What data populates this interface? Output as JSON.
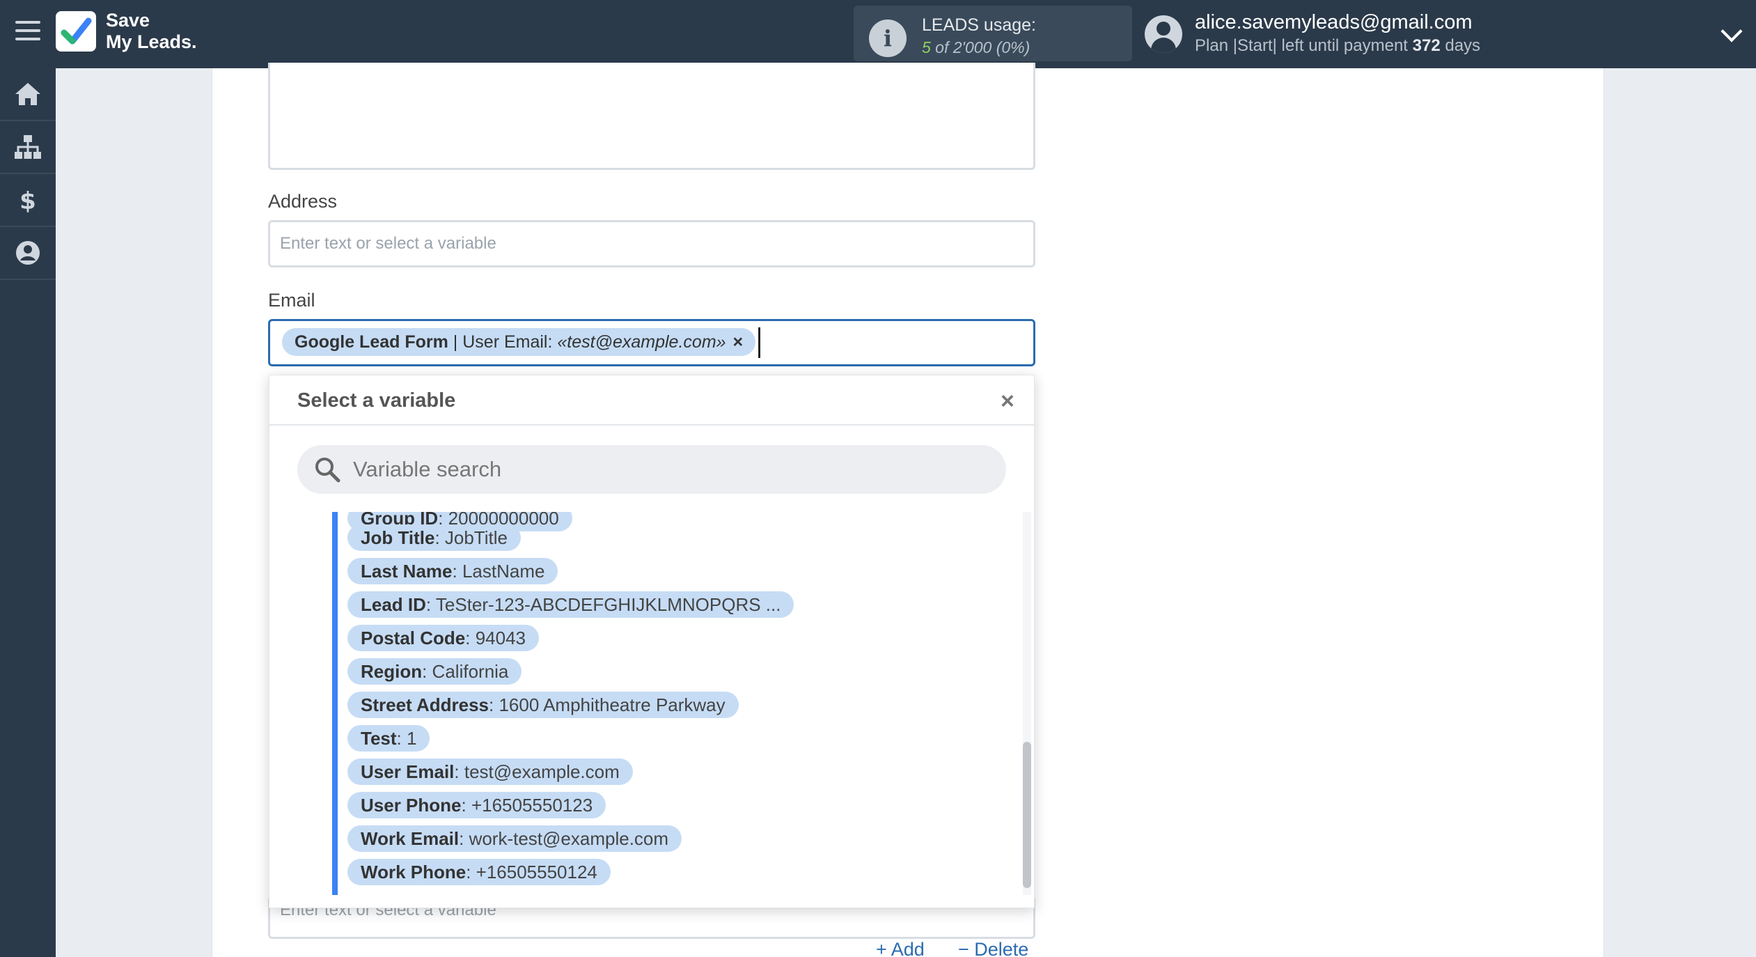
{
  "header": {
    "logo_line1": "Save",
    "logo_line2": "My Leads.",
    "leads_title": "LEADS usage:",
    "leads_used": "5",
    "leads_total": " of 2'000",
    "leads_percent": " (0%)",
    "user_email": "alice.savemyleads@gmail.com",
    "plan_prefix": "Plan |Start| left until payment ",
    "plan_days": "372",
    "plan_suffix": " days"
  },
  "sidebar": {
    "items": [
      {
        "name": "home-icon"
      },
      {
        "name": "sitemap-icon"
      },
      {
        "name": "dollar-icon"
      },
      {
        "name": "user-circle-icon"
      }
    ]
  },
  "form": {
    "address_label": "Address",
    "address_placeholder": "Enter text or select a variable",
    "email_label": "Email",
    "email_chip": {
      "source": "Google Lead Form",
      "separator": " | User Email: ",
      "value": "«test@example.com»",
      "remove": "×"
    },
    "bottom_placeholder": "Enter text or select a variable",
    "add_label": "+ Add",
    "delete_label": "− Delete"
  },
  "dropdown": {
    "title": "Select a variable",
    "close": "×",
    "search_placeholder": "Variable search",
    "items": [
      {
        "key": "Group ID",
        "value": ": 20000000000"
      },
      {
        "key": "Job Title",
        "value": ": JobTitle"
      },
      {
        "key": "Last Name",
        "value": ": LastName"
      },
      {
        "key": "Lead ID",
        "value": ": TeSter-123-ABCDEFGHIJKLMNOPQRS ..."
      },
      {
        "key": "Postal Code",
        "value": ": 94043"
      },
      {
        "key": "Region",
        "value": ": California"
      },
      {
        "key": "Street Address",
        "value": ": 1600 Amphitheatre Parkway"
      },
      {
        "key": "Test",
        "value": ": 1"
      },
      {
        "key": "User Email",
        "value": ": test@example.com"
      },
      {
        "key": "User Phone",
        "value": ": +16505550123"
      },
      {
        "key": "Work Email",
        "value": ": work-test@example.com"
      },
      {
        "key": "Work Phone",
        "value": ": +16505550124"
      }
    ]
  },
  "colors": {
    "topbar": "#2b3a4a",
    "chip": "#c6dcf5",
    "accent": "#3b82f6",
    "usage_green": "#8fd15f"
  }
}
